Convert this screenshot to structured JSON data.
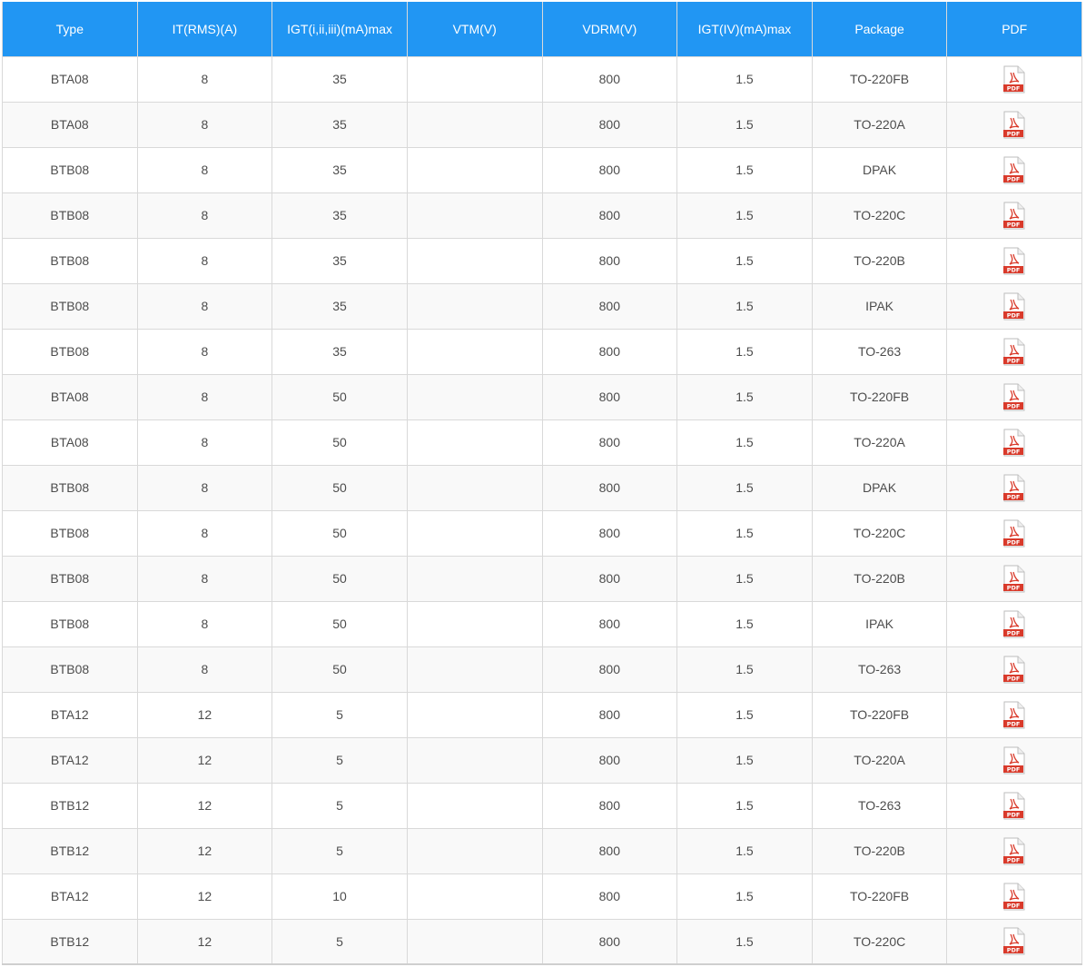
{
  "table": {
    "columns": [
      "Type",
      "IT(RMS)(A)",
      "IGT(i,ii,iii)(mA)max",
      "VTM(V)",
      "VDRM(V)",
      "IGT(IV)(mA)max",
      "Package",
      "PDF"
    ],
    "pdf_icon_label": "PDF",
    "pdf_icon": "pdf-file-icon",
    "header_color": "#2196f3",
    "pdf_icon_color": "#d93a2b",
    "rows": [
      {
        "type": "BTA08",
        "it_rms": "8",
        "igt_i_ii_iii": "35",
        "vtm": "",
        "vdrm": "800",
        "igt_iv": "1.5",
        "package": "TO-220FB"
      },
      {
        "type": "BTA08",
        "it_rms": "8",
        "igt_i_ii_iii": "35",
        "vtm": "",
        "vdrm": "800",
        "igt_iv": "1.5",
        "package": "TO-220A"
      },
      {
        "type": "BTB08",
        "it_rms": "8",
        "igt_i_ii_iii": "35",
        "vtm": "",
        "vdrm": "800",
        "igt_iv": "1.5",
        "package": "DPAK"
      },
      {
        "type": "BTB08",
        "it_rms": "8",
        "igt_i_ii_iii": "35",
        "vtm": "",
        "vdrm": "800",
        "igt_iv": "1.5",
        "package": "TO-220C"
      },
      {
        "type": "BTB08",
        "it_rms": "8",
        "igt_i_ii_iii": "35",
        "vtm": "",
        "vdrm": "800",
        "igt_iv": "1.5",
        "package": "TO-220B"
      },
      {
        "type": "BTB08",
        "it_rms": "8",
        "igt_i_ii_iii": "35",
        "vtm": "",
        "vdrm": "800",
        "igt_iv": "1.5",
        "package": "IPAK"
      },
      {
        "type": "BTB08",
        "it_rms": "8",
        "igt_i_ii_iii": "35",
        "vtm": "",
        "vdrm": "800",
        "igt_iv": "1.5",
        "package": "TO-263"
      },
      {
        "type": "BTA08",
        "it_rms": "8",
        "igt_i_ii_iii": "50",
        "vtm": "",
        "vdrm": "800",
        "igt_iv": "1.5",
        "package": "TO-220FB"
      },
      {
        "type": "BTA08",
        "it_rms": "8",
        "igt_i_ii_iii": "50",
        "vtm": "",
        "vdrm": "800",
        "igt_iv": "1.5",
        "package": "TO-220A"
      },
      {
        "type": "BTB08",
        "it_rms": "8",
        "igt_i_ii_iii": "50",
        "vtm": "",
        "vdrm": "800",
        "igt_iv": "1.5",
        "package": "DPAK"
      },
      {
        "type": "BTB08",
        "it_rms": "8",
        "igt_i_ii_iii": "50",
        "vtm": "",
        "vdrm": "800",
        "igt_iv": "1.5",
        "package": "TO-220C"
      },
      {
        "type": "BTB08",
        "it_rms": "8",
        "igt_i_ii_iii": "50",
        "vtm": "",
        "vdrm": "800",
        "igt_iv": "1.5",
        "package": "TO-220B"
      },
      {
        "type": "BTB08",
        "it_rms": "8",
        "igt_i_ii_iii": "50",
        "vtm": "",
        "vdrm": "800",
        "igt_iv": "1.5",
        "package": "IPAK"
      },
      {
        "type": "BTB08",
        "it_rms": "8",
        "igt_i_ii_iii": "50",
        "vtm": "",
        "vdrm": "800",
        "igt_iv": "1.5",
        "package": "TO-263"
      },
      {
        "type": "BTA12",
        "it_rms": "12",
        "igt_i_ii_iii": "5",
        "vtm": "",
        "vdrm": "800",
        "igt_iv": "1.5",
        "package": "TO-220FB"
      },
      {
        "type": "BTA12",
        "it_rms": "12",
        "igt_i_ii_iii": "5",
        "vtm": "",
        "vdrm": "800",
        "igt_iv": "1.5",
        "package": "TO-220A"
      },
      {
        "type": "BTB12",
        "it_rms": "12",
        "igt_i_ii_iii": "5",
        "vtm": "",
        "vdrm": "800",
        "igt_iv": "1.5",
        "package": "TO-263"
      },
      {
        "type": "BTB12",
        "it_rms": "12",
        "igt_i_ii_iii": "5",
        "vtm": "",
        "vdrm": "800",
        "igt_iv": "1.5",
        "package": "TO-220B"
      },
      {
        "type": "BTA12",
        "it_rms": "12",
        "igt_i_ii_iii": "10",
        "vtm": "",
        "vdrm": "800",
        "igt_iv": "1.5",
        "package": "TO-220FB"
      },
      {
        "type": "BTB12",
        "it_rms": "12",
        "igt_i_ii_iii": "5",
        "vtm": "",
        "vdrm": "800",
        "igt_iv": "1.5",
        "package": "TO-220C"
      }
    ]
  }
}
